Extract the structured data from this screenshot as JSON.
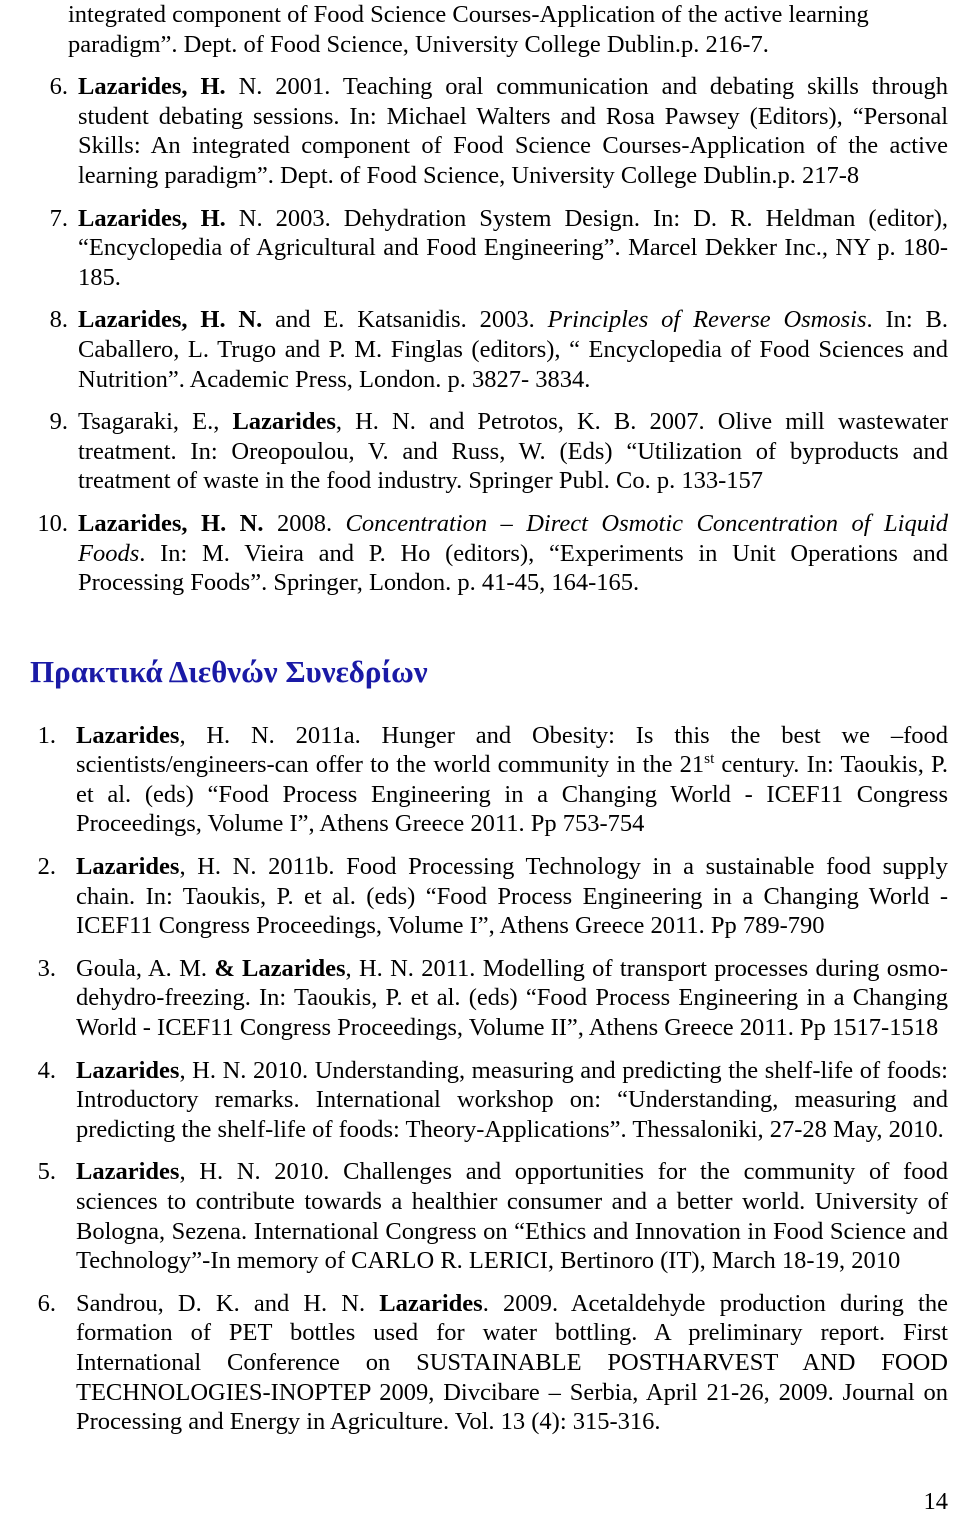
{
  "page": {
    "number": "14"
  },
  "continued_reference": {
    "text_line1": "integrated component of Food Science Courses-Application of the active learning",
    "text_line2": "paradigm”. Dept. of Food Science, University College Dublin.p. 216-7."
  },
  "publications_list": {
    "items": [
      {
        "number": "6.",
        "bold_lead": "Lazarides, H.",
        "rest": " N. 2001. Teaching oral communication and debating skills through student debating sessions. In: Michael Walters and Rosa Pawsey (Editors), “Personal Skills: An integrated component of Food Science Courses-Application of the active learning paradigm”. Dept. of Food Science, University College Dublin.p. 217-8"
      },
      {
        "number": "7.",
        "bold_lead": "Lazarides, H.",
        "rest": " N. 2003. Dehydration System Design. In: D. R. Heldman (editor), “Encyclopedia of Agricultural and Food Engineering”. Marcel Dekker Inc., NY p. 180-185."
      },
      {
        "number": "8.",
        "bold_lead": "Lazarides, H. N.",
        "rest_a": " and E. Katsanidis. 2003. ",
        "italic": "Principles of Reverse Osmosis",
        "rest_b": ". In: B. Caballero, L. Trugo and P. M. Finglas (editors), “ Encyclopedia of Food Sciences and Nutrition”. Academic Press, London. p. 3827- 3834."
      },
      {
        "number": "9.",
        "lead": "Tsagaraki, E., ",
        "bold_mid": "Lazarides",
        "rest": ", H. N. and Petrotos, K. B. 2007. Olive mill wastewater treatment. In: Oreopoulou, V. and Russ, W. (Eds) “Utilization of byproducts and treatment of waste in the food industry. Springer Publ. Co. p. 133-157"
      },
      {
        "number": "10.",
        "bold_lead": "Lazarides, H. N.",
        "rest_a": " 2008. ",
        "italic": "Concentration – Direct Osmotic Concentration of Liquid Foods",
        "rest_b": ". In: M. Vieira and P. Ho (editors), “Experiments in Unit Operations and Processing Foods”. Springer, London. p. 41-45, 164-165."
      }
    ]
  },
  "section_heading": {
    "title": "Πρακτικά Διεθνών Συνεδρίων",
    "color": "#1a1aa6"
  },
  "proceedings_list": {
    "items": [
      {
        "number": "1.",
        "bold_lead": "Lazarides",
        "rest_a": ", H. N. 2011a. Hunger and Obesity: Is this the best we –food scientists/engineers-can offer to the world community in the 21",
        "sup": "st",
        "rest_b": " century. In: Taoukis, P. et al. (eds) “Food Process Engineering in a Changing World - ICEF11 Congress Proceedings, Volume I”, Athens Greece 2011. Pp 753-754"
      },
      {
        "number": "2.",
        "bold_lead": "Lazarides",
        "rest": ", H. N. 2011b. Food Processing Technology in a sustainable food supply chain. In: Taoukis, P. et al. (eds) “Food Process Engineering in a Changing World - ICEF11 Congress Proceedings, Volume I”, Athens Greece 2011. Pp 789-790"
      },
      {
        "number": "3.",
        "lead": "Goula, A. M. ",
        "bold_mid": "& Lazarides",
        "rest": ", H. N. 2011. Modelling of transport processes during osmo-dehydro-freezing. In: Taoukis, P. et al. (eds) “Food Process Engineering in a Changing World - ICEF11 Congress Proceedings, Volume II”, Athens Greece 2011. Pp 1517-1518"
      },
      {
        "number": "4.",
        "bold_lead": "Lazarides",
        "rest": ", H. N. 2010. Understanding, measuring and predicting the shelf-life of foods: Introductory remarks. International workshop on: “Understanding, measuring and predicting the shelf-life of foods: Theory-Applications”. Thessaloniki, 27-28 May, 2010."
      },
      {
        "number": "5.",
        "bold_lead": "Lazarides",
        "rest": ", H. N.  2010. Challenges and opportunities for the community of food sciences to contribute towards a healthier consumer and a better world. University of Bologna, Sezena. International Congress on “Ethics and Innovation in Food Science and Technology”-In memory of CARLO R. LERICI, Bertinoro (IT), March 18-19, 2010"
      },
      {
        "number": "6.",
        "lead": "Sandrou, D. K. and H. N. ",
        "bold_mid": "Lazarides",
        "rest": ". 2009. Acetaldehyde production during the formation of PET bottles used for water bottling.  A preliminary report. First International Conference on SUSTAINABLE POSTHARVEST AND FOOD TECHNOLOGIES-INOPTEP 2009, Divcibare – Serbia, April 21-26, 2009. Journal on Processing and Energy in Agriculture. Vol. 13 (4): 315-316."
      }
    ]
  }
}
